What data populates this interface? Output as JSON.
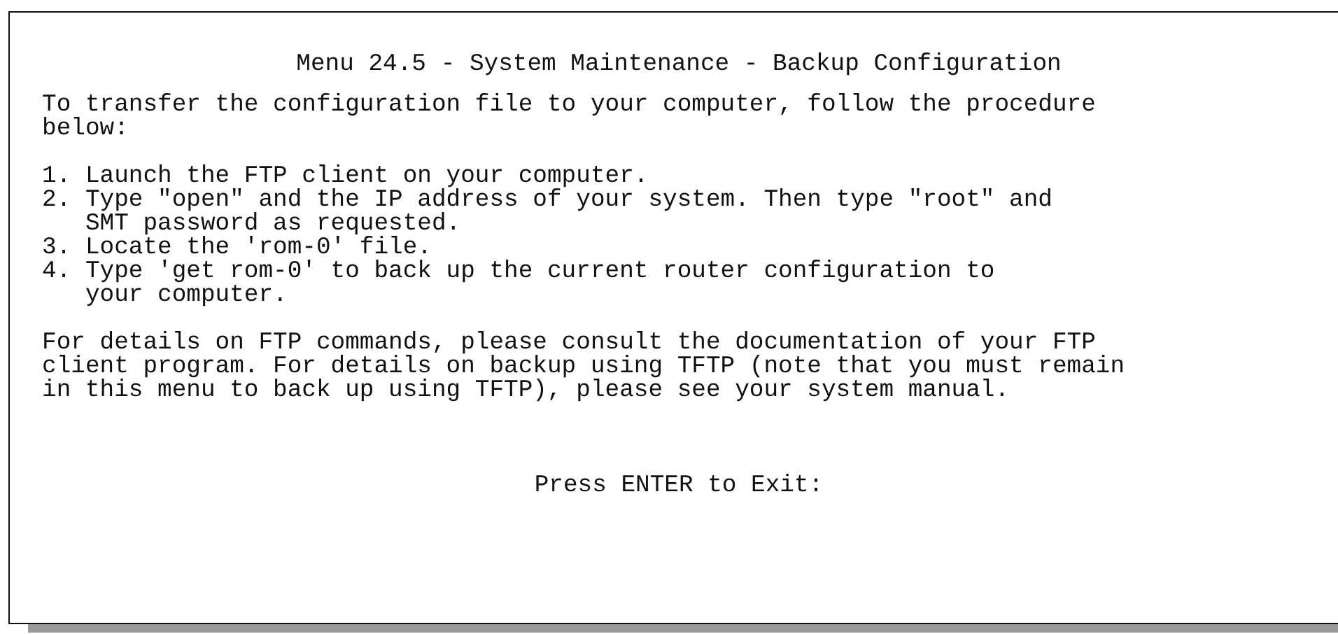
{
  "title": "Menu 24.5 - System Maintenance - Backup Configuration",
  "intro": "To transfer the configuration file to your computer, follow the procedure\nbelow:",
  "steps": [
    "1. Launch the FTP client on your computer.",
    "2. Type \"open\" and the IP address of your system. Then type \"root\" and\n   SMT password as requested.",
    "3. Locate the 'rom-0' file.",
    "4. Type 'get rom-0' to back up the current router configuration to\n   your computer."
  ],
  "details": "For details on FTP commands, please consult the documentation of your FTP\nclient program. For details on backup using TFTP (note that you must remain\nin this menu to back up using TFTP), please see your system manual.",
  "prompt": "Press ENTER to Exit:"
}
